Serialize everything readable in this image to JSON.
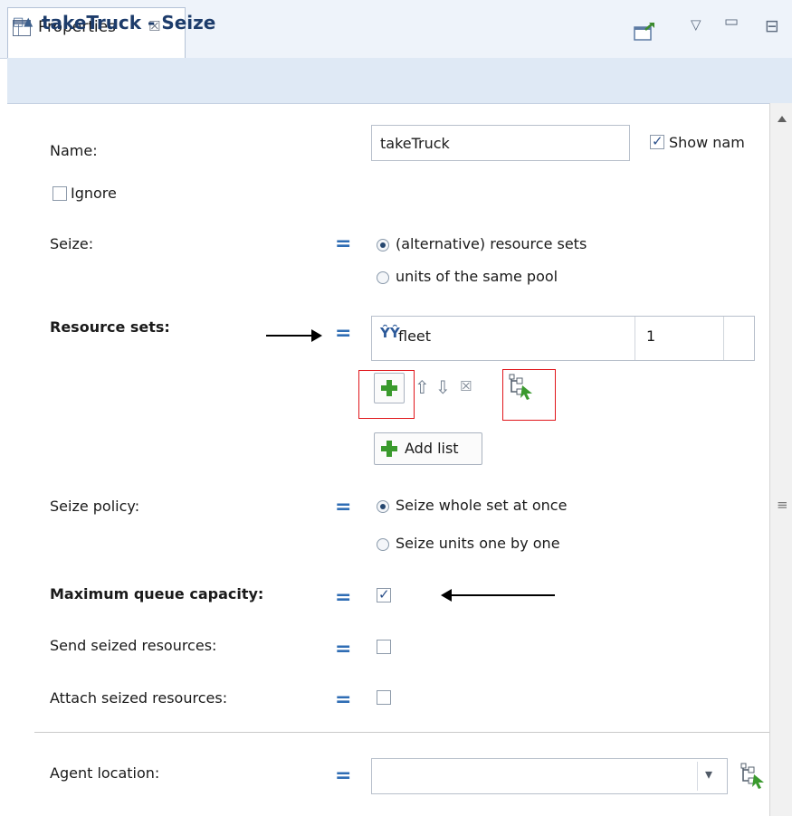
{
  "tab": {
    "label": "Properties",
    "close": "☒"
  },
  "header": {
    "collapse_glyph": "□▲",
    "title": "takeTruck - Seize"
  },
  "name_row": {
    "label": "Name:",
    "value": "takeTruck",
    "show_name_label": "Show nam",
    "show_name_checked": true
  },
  "ignore": {
    "label": "Ignore",
    "checked": false
  },
  "seize": {
    "label": "Seize:",
    "options": [
      "(alternative) resource sets",
      "units of the same pool"
    ],
    "selected": 0
  },
  "resource_sets": {
    "label": "Resource sets:",
    "rows": [
      {
        "name": "fleet",
        "count": "1"
      }
    ],
    "add_list_label": "Add list"
  },
  "seize_policy": {
    "label": "Seize policy:",
    "options": [
      "Seize whole set at once",
      "Seize units one by one"
    ],
    "selected": 0
  },
  "max_queue": {
    "label": "Maximum queue capacity:",
    "checked": true
  },
  "send_seized": {
    "label": "Send seized resources:",
    "checked": false
  },
  "attach_seized": {
    "label": "Attach seized resources:",
    "checked": false
  },
  "agent_location": {
    "label": "Agent location:",
    "value": ""
  },
  "icons": {
    "equals": "=",
    "up": "⇧",
    "down": "⇩",
    "delete": "☒",
    "dropdown": "▾",
    "scroll_grip": "≡",
    "menu": "▽",
    "minimize": "▭",
    "maximize": "⊟"
  }
}
